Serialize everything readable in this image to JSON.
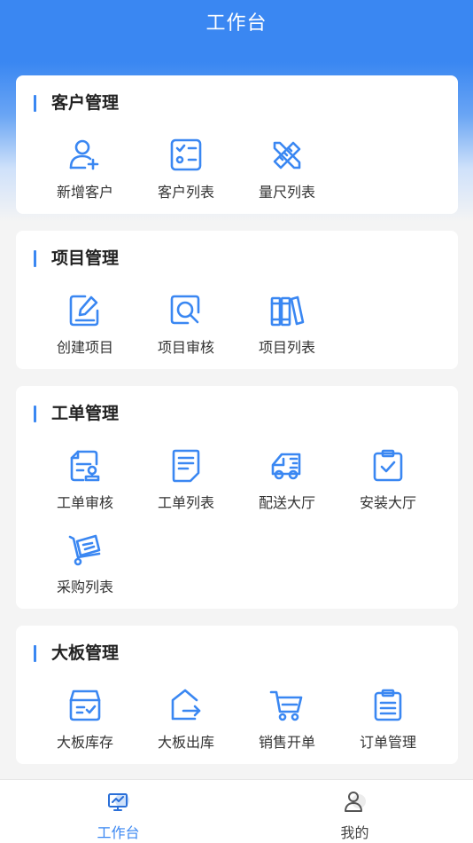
{
  "header": {
    "title": "工作台"
  },
  "colors": {
    "accent": "#3a87f2",
    "tab_inactive": "#444444"
  },
  "sections": [
    {
      "title": "客户管理",
      "items": [
        {
          "label": "新增客户",
          "icon": "add-user-icon"
        },
        {
          "label": "客户列表",
          "icon": "checklist-icon"
        },
        {
          "label": "量尺列表",
          "icon": "ruler-pencil-icon"
        }
      ]
    },
    {
      "title": "项目管理",
      "items": [
        {
          "label": "创建项目",
          "icon": "edit-document-icon"
        },
        {
          "label": "项目审核",
          "icon": "magnify-review-icon"
        },
        {
          "label": "项目列表",
          "icon": "binders-icon"
        }
      ]
    },
    {
      "title": "工单管理",
      "items": [
        {
          "label": "工单审核",
          "icon": "stamp-document-icon"
        },
        {
          "label": "工单列表",
          "icon": "document-list-icon"
        },
        {
          "label": "配送大厅",
          "icon": "delivery-van-icon"
        },
        {
          "label": "安装大厅",
          "icon": "clipboard-check-icon"
        },
        {
          "label": "采购列表",
          "icon": "hand-truck-icon"
        }
      ]
    },
    {
      "title": "大板管理",
      "items": [
        {
          "label": "大板库存",
          "icon": "inventory-box-icon"
        },
        {
          "label": "大板出库",
          "icon": "house-exit-icon"
        },
        {
          "label": "销售开单",
          "icon": "shopping-cart-icon"
        },
        {
          "label": "订单管理",
          "icon": "order-clipboard-icon"
        }
      ]
    }
  ],
  "tabbar": [
    {
      "label": "工作台",
      "icon": "monitor-icon",
      "active": true
    },
    {
      "label": "我的",
      "icon": "user-profile-icon",
      "active": false
    }
  ]
}
